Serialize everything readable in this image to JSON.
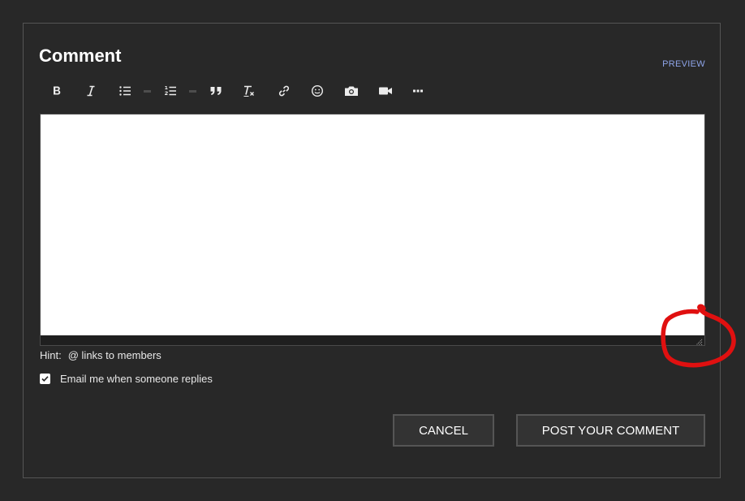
{
  "header": {
    "title": "Comment",
    "preview_label": "PREVIEW"
  },
  "toolbar": {
    "items": [
      {
        "name": "bold",
        "icon": "bold-icon"
      },
      {
        "name": "italic",
        "icon": "italic-icon"
      },
      {
        "name": "bulleted-list",
        "icon": "bulleted-list-icon"
      },
      {
        "name": "numbered-list",
        "icon": "numbered-list-icon"
      },
      {
        "name": "blockquote",
        "icon": "quote-icon"
      },
      {
        "name": "clear-formatting",
        "icon": "clear-formatting-icon"
      },
      {
        "name": "link",
        "icon": "link-icon"
      },
      {
        "name": "emoji",
        "icon": "smiley-icon"
      },
      {
        "name": "image",
        "icon": "camera-icon"
      },
      {
        "name": "video",
        "icon": "video-camera-icon"
      },
      {
        "name": "more",
        "icon": "more-icon"
      }
    ]
  },
  "editor": {
    "value": "",
    "placeholder": ""
  },
  "hint": {
    "label": "Hint:",
    "text": "@ links to members"
  },
  "email_option": {
    "label": "Email me when someone replies",
    "checked": true
  },
  "actions": {
    "cancel_label": "CANCEL",
    "post_label": "POST YOUR COMMENT"
  },
  "colors": {
    "background": "#282828",
    "preview_link": "#8ea4e8",
    "annotation": "#e01010"
  }
}
